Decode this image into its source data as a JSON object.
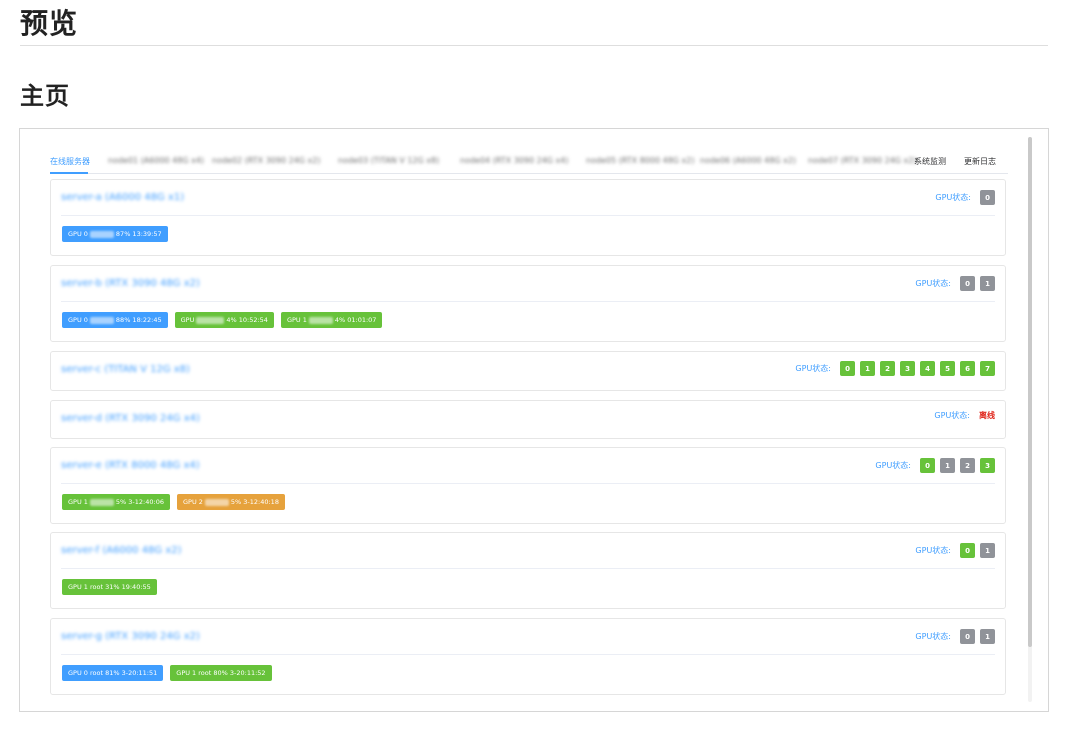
{
  "page": {
    "title": "预览",
    "section_title": "主页"
  },
  "tabs": [
    {
      "label": "在线服务器",
      "active": true
    },
    {
      "label": "node01 (A6000 48G x4)",
      "active": false,
      "blurred": true
    },
    {
      "label": "node02 (RTX 3090 24G x2)",
      "active": false,
      "blurred": true
    },
    {
      "label": "node03 (TITAN V 12G x8)",
      "active": false,
      "blurred": true
    },
    {
      "label": "node04 (RTX 3090 24G x4)",
      "active": false,
      "blurred": true
    },
    {
      "label": "node05 (RTX 8000 48G x2)",
      "active": false,
      "blurred": true
    },
    {
      "label": "node06 (A6000 48G x2)",
      "active": false,
      "blurred": true
    },
    {
      "label": "node07 (RTX 3090 24G x2)",
      "active": false,
      "blurred": true
    },
    {
      "label": "系统监测",
      "active": false
    },
    {
      "label": "更新日志",
      "active": false
    }
  ],
  "gpu_status_label": "GPU状态:",
  "servers": [
    {
      "name": "server-a (A6000 48G x1)",
      "gpus": [
        {
          "id": "0",
          "state": "idle"
        }
      ],
      "processes": [
        {
          "color": "blue",
          "prefix": "GPU 0",
          "suffix": "87% 13:39:57"
        }
      ]
    },
    {
      "name": "server-b (RTX 3090 48G x2)",
      "gpus": [
        {
          "id": "0",
          "state": "idle"
        },
        {
          "id": "1",
          "state": "idle"
        }
      ],
      "processes": [
        {
          "color": "blue",
          "prefix": "GPU 0",
          "suffix": "88% 18:22:45"
        },
        {
          "color": "green",
          "prefix": "GPU",
          "suffix": "4% 10:52:54"
        },
        {
          "color": "green",
          "prefix": "GPU 1",
          "suffix": "4% 01:01:07"
        }
      ]
    },
    {
      "name": "server-c (TITAN V 12G x8)",
      "gpus": [
        {
          "id": "0",
          "state": "free"
        },
        {
          "id": "1",
          "state": "free"
        },
        {
          "id": "2",
          "state": "free"
        },
        {
          "id": "3",
          "state": "free"
        },
        {
          "id": "4",
          "state": "free"
        },
        {
          "id": "5",
          "state": "free"
        },
        {
          "id": "6",
          "state": "free"
        },
        {
          "id": "7",
          "state": "free"
        }
      ],
      "processes": []
    },
    {
      "name": "server-d (RTX 3090 24G x4)",
      "offline_text": "离线",
      "gpus": [],
      "processes": []
    },
    {
      "name": "server-e (RTX 8000 48G x4)",
      "gpus": [
        {
          "id": "0",
          "state": "free"
        },
        {
          "id": "1",
          "state": "idle"
        },
        {
          "id": "2",
          "state": "idle"
        },
        {
          "id": "3",
          "state": "free"
        }
      ],
      "processes": [
        {
          "color": "green",
          "prefix": "GPU 1",
          "suffix": "5% 3-12:40:06"
        },
        {
          "color": "orange",
          "prefix": "GPU 2",
          "suffix": "5% 3-12:40:18"
        }
      ]
    },
    {
      "name": "server-f (A6000 48G x2)",
      "gpus": [
        {
          "id": "0",
          "state": "free"
        },
        {
          "id": "1",
          "state": "idle"
        }
      ],
      "processes": [
        {
          "color": "green",
          "prefix": "GPU 1 root 31% 19:40:55",
          "suffix": "",
          "plain": true
        }
      ]
    },
    {
      "name": "server-g (RTX 3090 24G x2)",
      "gpus": [
        {
          "id": "0",
          "state": "idle"
        },
        {
          "id": "1",
          "state": "idle"
        }
      ],
      "processes": [
        {
          "color": "blue",
          "prefix": "GPU 0 root 81% 3-20:11:51",
          "suffix": "",
          "plain": true
        },
        {
          "color": "green",
          "prefix": "GPU 1 root 80% 3-20:11:52",
          "suffix": "",
          "plain": true
        }
      ]
    }
  ],
  "colors": {
    "accent": "#409eff",
    "free": "#67c23a",
    "idle": "#909399",
    "warning": "#e6a23c",
    "offline": "#e0261b"
  }
}
